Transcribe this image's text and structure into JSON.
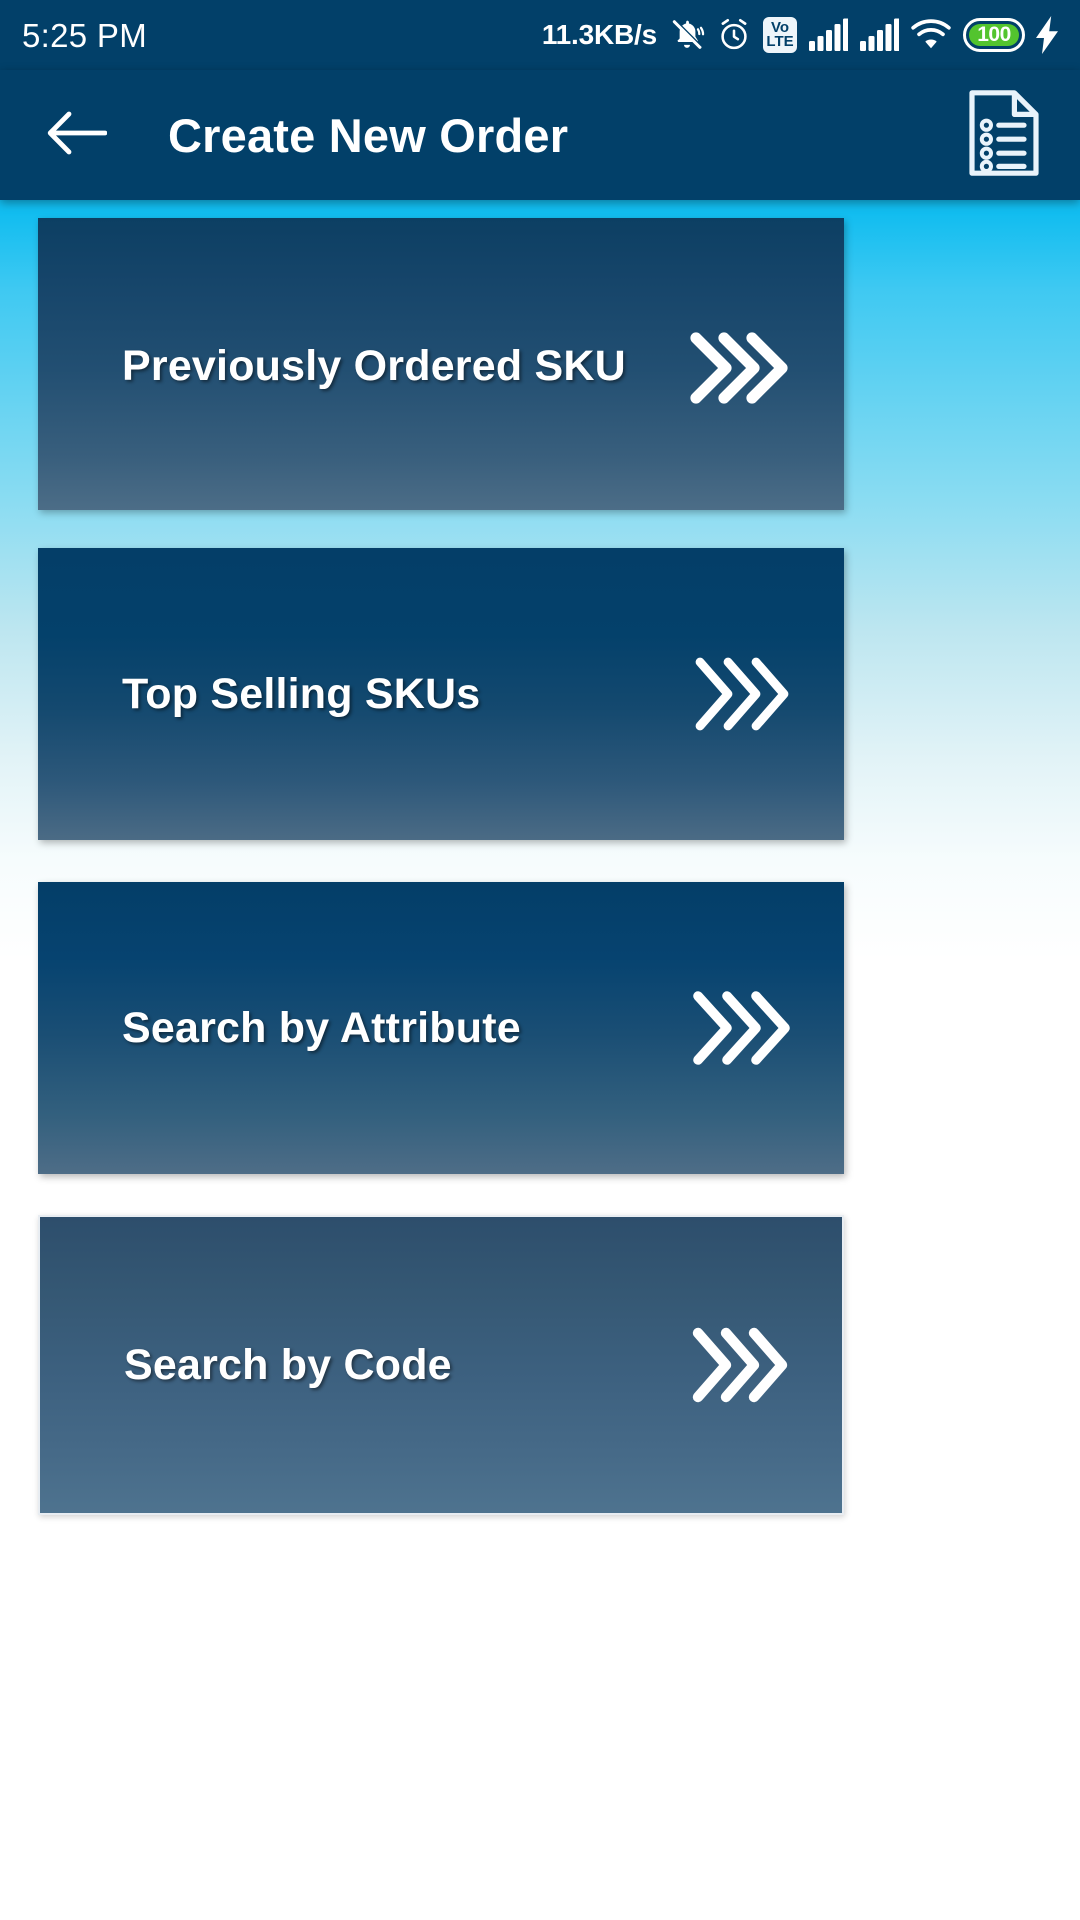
{
  "status_bar": {
    "time": "5:25 PM",
    "network_speed": "11.3KB/s",
    "icons": [
      "bell-muted-icon",
      "alarm-clock-icon",
      "volte-icon",
      "signal-bars-sim1-icon",
      "signal-bars-sim2-icon",
      "wifi-icon",
      "battery-icon",
      "charging-bolt-icon"
    ],
    "volte_top": "Vo",
    "volte_bottom": "LTE",
    "battery_percent": "100",
    "battery_color": "#53c42e"
  },
  "app_bar": {
    "title": "Create New Order",
    "back_icon": "back-arrow-icon",
    "action_icon": "order-list-document-icon",
    "background_color": "#024069"
  },
  "theme": {
    "accent": "#024069",
    "background_top": "#12bdf0",
    "background_bottom": "#ffffff",
    "card_text_color": "#ffffff"
  },
  "menu": {
    "items": [
      {
        "label": "Previously Ordered SKU",
        "name": "previously-ordered-sku",
        "arrow_icon": "triple-chevron-right-icon"
      },
      {
        "label": "Top Selling SKUs",
        "name": "top-selling-skus",
        "arrow_icon": "triple-chevron-right-icon"
      },
      {
        "label": "Search by Attribute",
        "name": "search-by-attribute",
        "arrow_icon": "triple-chevron-right-icon"
      },
      {
        "label": "Search by Code",
        "name": "search-by-code",
        "arrow_icon": "triple-chevron-right-icon"
      }
    ]
  }
}
